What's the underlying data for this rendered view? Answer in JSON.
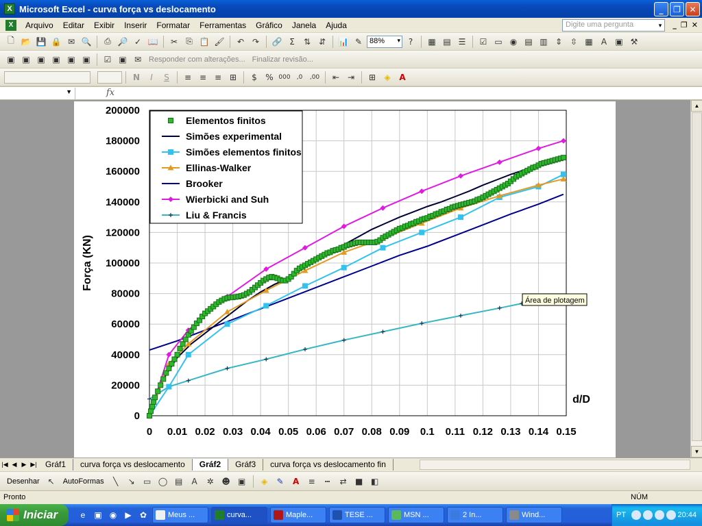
{
  "window": {
    "title": "Microsoft Excel - curva força vs deslocamento"
  },
  "menu": {
    "items": [
      "Arquivo",
      "Editar",
      "Exibir",
      "Inserir",
      "Formatar",
      "Ferramentas",
      "Gráfico",
      "Janela",
      "Ajuda"
    ],
    "help_placeholder": "Digite uma pergunta"
  },
  "toolbar": {
    "zoom": "88%",
    "reply_label": "Responder com alterações...",
    "end_review_label": "Finalizar revisão..."
  },
  "formula_bar": {
    "fx": "fx"
  },
  "sheet_tabs": {
    "tabs": [
      "Gráf1",
      "curva força vs deslocamento",
      "Gráf2",
      "Gráf3",
      "curva força vs deslocamento fin"
    ],
    "active": "Gráf2"
  },
  "draw_toolbar": {
    "draw_label": "Desenhar",
    "autoshapes_label": "AutoFormas"
  },
  "status": {
    "left": "Pronto",
    "num": "NÚM"
  },
  "taskbar": {
    "start_label": "Iniciar",
    "buttons": [
      "Meus ...",
      "curva...",
      "Maple...",
      "TESE ...",
      "MSN ...",
      "2 In...",
      "Wind..."
    ],
    "active_button": "curva...",
    "lang": "PT",
    "clock": "20:44"
  },
  "tooltip": "Área de plotagem",
  "colors": {
    "elementos_finitos": "#2db82d",
    "simoes_experimental": "#000033",
    "simoes_ef": "#33c2ee",
    "ellinas": "#e39a22",
    "brooker": "#00008b",
    "wierbicki": "#e01be0",
    "liu": "#37b6c4"
  },
  "chart_data": {
    "type": "line",
    "xlabel": "d/D",
    "ylabel": "Força (KN)",
    "xlim": [
      0,
      0.15
    ],
    "ylim": [
      0,
      200000
    ],
    "xticks": [
      "0",
      "0.01",
      "0.02",
      "0.03",
      "0.04",
      "0.05",
      "0.06",
      "0.07",
      "0.08",
      "0.09",
      "0.1",
      "0.11",
      "0.12",
      "0.13",
      "0.14",
      "0.15"
    ],
    "yticks": [
      "0",
      "20000",
      "40000",
      "60000",
      "80000",
      "100000",
      "120000",
      "140000",
      "160000",
      "180000",
      "200000"
    ],
    "grid": true,
    "legend": "top-left",
    "series": [
      {
        "name": "Elementos finitos",
        "marker": "square",
        "line": false,
        "points": [
          [
            0,
            0
          ],
          [
            0.0005,
            3000
          ],
          [
            0.001,
            6000
          ],
          [
            0.0015,
            9000
          ],
          [
            0.002,
            12000
          ],
          [
            0.003,
            16000
          ],
          [
            0.004,
            20000
          ],
          [
            0.005,
            24000
          ],
          [
            0.006,
            28000
          ],
          [
            0.007,
            31000
          ],
          [
            0.008,
            34000
          ],
          [
            0.009,
            37000
          ],
          [
            0.01,
            40000
          ],
          [
            0.011,
            44000
          ],
          [
            0.012,
            47000
          ],
          [
            0.013,
            50000
          ],
          [
            0.014,
            53000
          ],
          [
            0.015,
            55500
          ],
          [
            0.016,
            58000
          ],
          [
            0.017,
            60500
          ],
          [
            0.018,
            62500
          ],
          [
            0.019,
            65000
          ],
          [
            0.02,
            67000
          ],
          [
            0.021,
            68500
          ],
          [
            0.022,
            70000
          ],
          [
            0.023,
            71500
          ],
          [
            0.024,
            73000
          ],
          [
            0.025,
            74500
          ],
          [
            0.026,
            75500
          ],
          [
            0.027,
            76500
          ],
          [
            0.028,
            77000
          ],
          [
            0.029,
            77500
          ],
          [
            0.03,
            77500
          ],
          [
            0.031,
            77800
          ],
          [
            0.032,
            78000
          ],
          [
            0.033,
            78500
          ],
          [
            0.034,
            79000
          ],
          [
            0.035,
            80000
          ],
          [
            0.036,
            81000
          ],
          [
            0.037,
            82500
          ],
          [
            0.038,
            84000
          ],
          [
            0.039,
            85500
          ],
          [
            0.04,
            87000
          ],
          [
            0.041,
            88500
          ],
          [
            0.042,
            89500
          ],
          [
            0.043,
            90500
          ],
          [
            0.044,
            91000
          ],
          [
            0.045,
            90500
          ],
          [
            0.046,
            90000
          ],
          [
            0.047,
            89000
          ],
          [
            0.048,
            88500
          ],
          [
            0.049,
            88500
          ],
          [
            0.05,
            89500
          ],
          [
            0.051,
            91000
          ],
          [
            0.052,
            93000
          ],
          [
            0.053,
            95000
          ],
          [
            0.054,
            96500
          ],
          [
            0.055,
            97500
          ],
          [
            0.056,
            98500
          ],
          [
            0.057,
            99500
          ],
          [
            0.058,
            100500
          ],
          [
            0.059,
            101500
          ],
          [
            0.06,
            102500
          ],
          [
            0.061,
            103500
          ],
          [
            0.062,
            104500
          ],
          [
            0.063,
            105500
          ],
          [
            0.064,
            106500
          ],
          [
            0.065,
            107000
          ],
          [
            0.066,
            108000
          ],
          [
            0.067,
            108500
          ],
          [
            0.068,
            109000
          ],
          [
            0.069,
            110000
          ],
          [
            0.07,
            110500
          ],
          [
            0.071,
            111500
          ],
          [
            0.072,
            112000
          ],
          [
            0.073,
            112500
          ],
          [
            0.074,
            113000
          ],
          [
            0.075,
            113500
          ],
          [
            0.076,
            113500
          ],
          [
            0.077,
            113500
          ],
          [
            0.078,
            113500
          ],
          [
            0.079,
            113500
          ],
          [
            0.08,
            113500
          ],
          [
            0.081,
            113500
          ],
          [
            0.082,
            114000
          ],
          [
            0.083,
            115000
          ],
          [
            0.084,
            116500
          ],
          [
            0.085,
            117500
          ],
          [
            0.086,
            118500
          ],
          [
            0.087,
            119500
          ],
          [
            0.088,
            120500
          ],
          [
            0.089,
            121500
          ],
          [
            0.09,
            122500
          ],
          [
            0.091,
            123000
          ],
          [
            0.092,
            124000
          ],
          [
            0.093,
            124500
          ],
          [
            0.094,
            125500
          ],
          [
            0.095,
            126000
          ],
          [
            0.096,
            127000
          ],
          [
            0.097,
            127500
          ],
          [
            0.098,
            128500
          ],
          [
            0.099,
            129000
          ],
          [
            0.1,
            129500
          ],
          [
            0.101,
            130500
          ],
          [
            0.102,
            131000
          ],
          [
            0.103,
            132000
          ],
          [
            0.104,
            132500
          ],
          [
            0.105,
            133500
          ],
          [
            0.106,
            134000
          ],
          [
            0.107,
            135000
          ],
          [
            0.108,
            135500
          ],
          [
            0.109,
            136500
          ],
          [
            0.11,
            137000
          ],
          [
            0.111,
            137500
          ],
          [
            0.112,
            138000
          ],
          [
            0.113,
            138500
          ],
          [
            0.114,
            139000
          ],
          [
            0.115,
            139500
          ],
          [
            0.116,
            140000
          ],
          [
            0.117,
            140500
          ],
          [
            0.118,
            141500
          ],
          [
            0.119,
            142000
          ],
          [
            0.12,
            143000
          ],
          [
            0.121,
            144000
          ],
          [
            0.122,
            145000
          ],
          [
            0.123,
            146000
          ],
          [
            0.124,
            147000
          ],
          [
            0.125,
            148000
          ],
          [
            0.126,
            149000
          ],
          [
            0.127,
            150000
          ],
          [
            0.128,
            151000
          ],
          [
            0.129,
            152000
          ],
          [
            0.13,
            153500
          ],
          [
            0.131,
            155000
          ],
          [
            0.132,
            156500
          ],
          [
            0.133,
            157500
          ],
          [
            0.134,
            158500
          ],
          [
            0.135,
            159500
          ],
          [
            0.136,
            160500
          ],
          [
            0.137,
            161500
          ],
          [
            0.138,
            162500
          ],
          [
            0.139,
            163000
          ],
          [
            0.14,
            164000
          ],
          [
            0.141,
            165000
          ],
          [
            0.142,
            165500
          ],
          [
            0.143,
            166000
          ],
          [
            0.144,
            166500
          ],
          [
            0.145,
            167000
          ],
          [
            0.146,
            167500
          ],
          [
            0.147,
            168000
          ],
          [
            0.148,
            168500
          ],
          [
            0.149,
            169000
          ]
        ]
      },
      {
        "name": "Simões experimental",
        "marker": "none",
        "line": true,
        "points": [
          [
            0,
            0
          ],
          [
            0.002,
            12000
          ],
          [
            0.005,
            24000
          ],
          [
            0.01,
            38000
          ],
          [
            0.015,
            47000
          ],
          [
            0.02,
            54000
          ],
          [
            0.025,
            61000
          ],
          [
            0.03,
            68000
          ],
          [
            0.035,
            75000
          ],
          [
            0.04,
            81000
          ],
          [
            0.045,
            86000
          ],
          [
            0.05,
            90000
          ],
          [
            0.055,
            96000
          ],
          [
            0.06,
            102000
          ],
          [
            0.065,
            107000
          ],
          [
            0.07,
            112000
          ],
          [
            0.075,
            117000
          ],
          [
            0.08,
            122000
          ],
          [
            0.085,
            126000
          ],
          [
            0.09,
            130000
          ],
          [
            0.095,
            133500
          ],
          [
            0.1,
            137000
          ],
          [
            0.105,
            140000
          ],
          [
            0.11,
            143500
          ],
          [
            0.115,
            147000
          ],
          [
            0.12,
            151000
          ],
          [
            0.125,
            154500
          ],
          [
            0.13,
            158000
          ],
          [
            0.135,
            161000
          ],
          [
            0.14,
            164000
          ],
          [
            0.145,
            166500
          ],
          [
            0.149,
            168000
          ]
        ]
      },
      {
        "name": "Simões elementos finitos",
        "marker": "square",
        "line": true,
        "points": [
          [
            0,
            0
          ],
          [
            0.007,
            19000
          ],
          [
            0.014,
            40000
          ],
          [
            0.028,
            60000
          ],
          [
            0.042,
            72000
          ],
          [
            0.056,
            85000
          ],
          [
            0.07,
            97000
          ],
          [
            0.084,
            110000
          ],
          [
            0.098,
            120000
          ],
          [
            0.112,
            130000
          ],
          [
            0.126,
            143000
          ],
          [
            0.14,
            150000
          ],
          [
            0.149,
            158000
          ]
        ]
      },
      {
        "name": "Ellinas-Walker",
        "marker": "triangle",
        "line": true,
        "points": [
          [
            0,
            0
          ],
          [
            0.007,
            34000
          ],
          [
            0.014,
            47000
          ],
          [
            0.028,
            68000
          ],
          [
            0.042,
            82000
          ],
          [
            0.056,
            95000
          ],
          [
            0.07,
            107000
          ],
          [
            0.084,
            116000
          ],
          [
            0.098,
            126000
          ],
          [
            0.112,
            136000
          ],
          [
            0.126,
            144000
          ],
          [
            0.14,
            151000
          ],
          [
            0.149,
            155000
          ]
        ]
      },
      {
        "name": "Brooker",
        "marker": "none",
        "line": true,
        "points": [
          [
            0,
            43000
          ],
          [
            0.01,
            49000
          ],
          [
            0.02,
            56000
          ],
          [
            0.03,
            63000
          ],
          [
            0.04,
            70000
          ],
          [
            0.05,
            77000
          ],
          [
            0.06,
            84000
          ],
          [
            0.07,
            91000
          ],
          [
            0.08,
            98000
          ],
          [
            0.09,
            105000
          ],
          [
            0.1,
            111000
          ],
          [
            0.11,
            118000
          ],
          [
            0.12,
            125000
          ],
          [
            0.13,
            132000
          ],
          [
            0.14,
            138500
          ],
          [
            0.149,
            145000
          ]
        ]
      },
      {
        "name": "Wierbicki and Suh",
        "marker": "diamond",
        "line": true,
        "points": [
          [
            0,
            0
          ],
          [
            0.007,
            40000
          ],
          [
            0.014,
            56000
          ],
          [
            0.028,
            78000
          ],
          [
            0.042,
            96000
          ],
          [
            0.056,
            110000
          ],
          [
            0.07,
            124000
          ],
          [
            0.084,
            136000
          ],
          [
            0.098,
            147000
          ],
          [
            0.112,
            157000
          ],
          [
            0.126,
            166000
          ],
          [
            0.14,
            175000
          ],
          [
            0.149,
            180000
          ]
        ]
      },
      {
        "name": "Liu & Francis",
        "marker": "plus",
        "line": true,
        "points": [
          [
            0,
            11000
          ],
          [
            0.007,
            19000
          ],
          [
            0.014,
            23000
          ],
          [
            0.028,
            31000
          ],
          [
            0.042,
            37000
          ],
          [
            0.056,
            43500
          ],
          [
            0.07,
            49500
          ],
          [
            0.084,
            55000
          ],
          [
            0.098,
            60500
          ],
          [
            0.112,
            65500
          ],
          [
            0.126,
            70500
          ],
          [
            0.134,
            73500
          ]
        ]
      }
    ]
  }
}
